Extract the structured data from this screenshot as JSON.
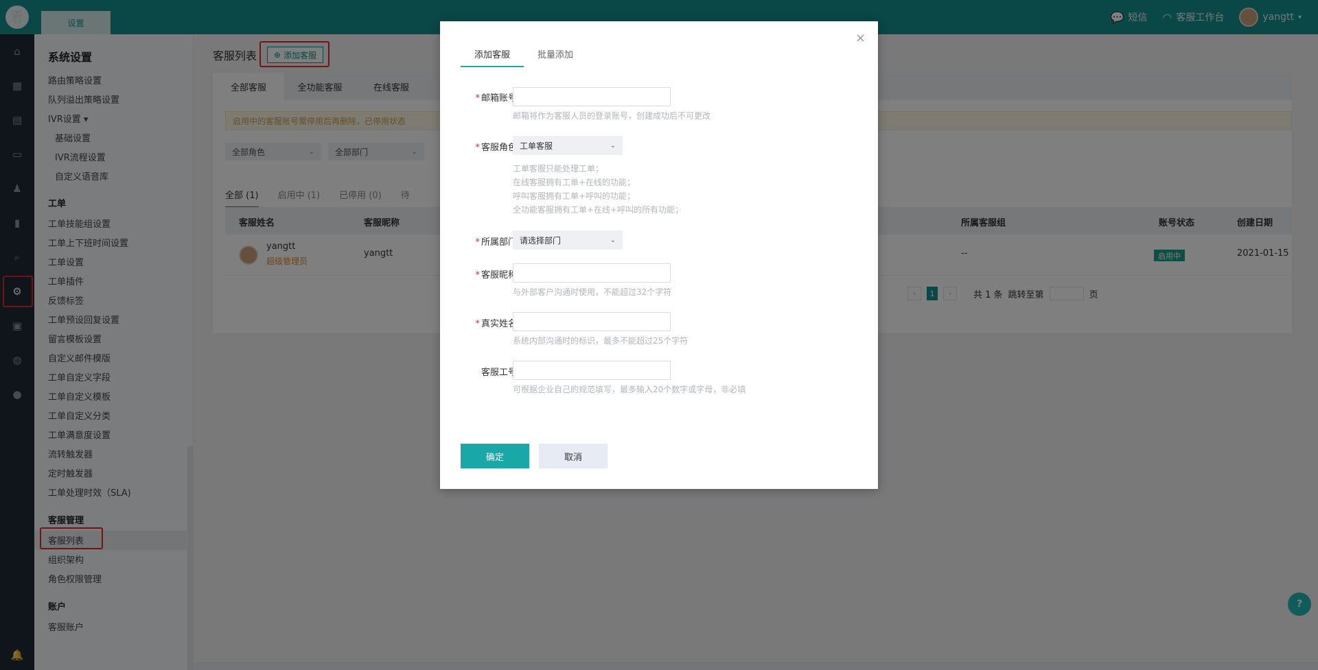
{
  "topbar": {
    "logo_glyph": "🦷",
    "tab_label": "设置",
    "sms_label": "短信",
    "workbench_label": "客服工作台",
    "user_name": "yangtt"
  },
  "rail": {
    "icons": [
      "home-icon",
      "apps-icon",
      "doc-icon",
      "chat-icon",
      "user-icon",
      "chart-icon",
      "search-icon",
      "settings-icon",
      "monitor-icon",
      "globe-icon",
      "account-icon",
      "bell-icon"
    ]
  },
  "sidemenu": {
    "title": "系统设置",
    "items_routing": [
      "路由策略设置",
      "队列溢出策略设置",
      "IVR设置 ▾"
    ],
    "items_ivr": [
      "基础设置",
      "IVR流程设置",
      "自定义语音库"
    ],
    "sec_ticket": "工单",
    "items_ticket": [
      "工单技能组设置",
      "工单上下班时间设置",
      "工单设置",
      "工单插件",
      "反馈标签",
      "工单预设回复设置",
      "留言模板设置",
      "自定义邮件模版",
      "工单自定义字段",
      "工单自定义模板",
      "工单自定义分类",
      "工单满意度设置",
      "流转触发器",
      "定时触发器",
      "工单处理时效（SLA)"
    ],
    "sec_agent": "客服管理",
    "items_agent": [
      "客服列表",
      "组织架构",
      "角色权限管理"
    ],
    "sec_account": "账户",
    "items_account": [
      "客服账户"
    ]
  },
  "main": {
    "page_title": "客服列表",
    "add_button": "添加客服",
    "tabs": [
      "全部客服",
      "全功能客服",
      "在线客服"
    ],
    "notice": "启用中的客服账号需停用后再删除，已停用状态",
    "filter_role": "全部角色",
    "filter_dept": "全部部门",
    "subtabs": [
      "全部 (1)",
      "启用中 (1)",
      "已停用 (0)",
      "待"
    ],
    "columns": [
      "客服姓名",
      "客服昵称",
      "所属客服组",
      "账号状态",
      "创建日期"
    ],
    "row": {
      "name": "yangtt",
      "role": "超级管理员",
      "nickname": "yangtt",
      "group": "--",
      "status": "启用中",
      "date": "2021-01-15"
    },
    "pager": {
      "current": "1",
      "total": "共 1 条",
      "jump_label": "跳转至第",
      "page_suffix": "页"
    }
  },
  "modal": {
    "close": "×",
    "tab_add": "添加客服",
    "tab_batch": "批量添加",
    "required_mark": "*",
    "email_label": "邮箱账号",
    "email_hint": "邮箱将作为客服人员的登录账号，创建成功后不可更改",
    "role_label": "客服角色",
    "role_value": "工单客服",
    "role_hints": [
      "工单客服只能处理工单；",
      "在线客服拥有工单+在线的功能；",
      "呼叫客服拥有工单+呼叫的功能；",
      "全功能客服拥有工单+在线+呼叫的所有功能；"
    ],
    "dept_label": "所属部门",
    "dept_placeholder": "请选择部门",
    "nick_label": "客服昵称",
    "nick_hint": "与外部客户沟通时使用，不能超过32个字符",
    "real_label": "真实姓名",
    "real_hint": "系统内部沟通时的标识，最多不能超过25个字符",
    "id_label": "客服工号",
    "id_hint": "可根据企业自己的规范填写，最多输入20个数字或字母，非必填",
    "ok_button": "确定",
    "cancel_button": "取消"
  },
  "help": {
    "label": "?"
  },
  "colors": {
    "brand": "#148f8f",
    "accent": "#1aa7a7",
    "required": "#e02828",
    "status": "#1a9e8a"
  }
}
